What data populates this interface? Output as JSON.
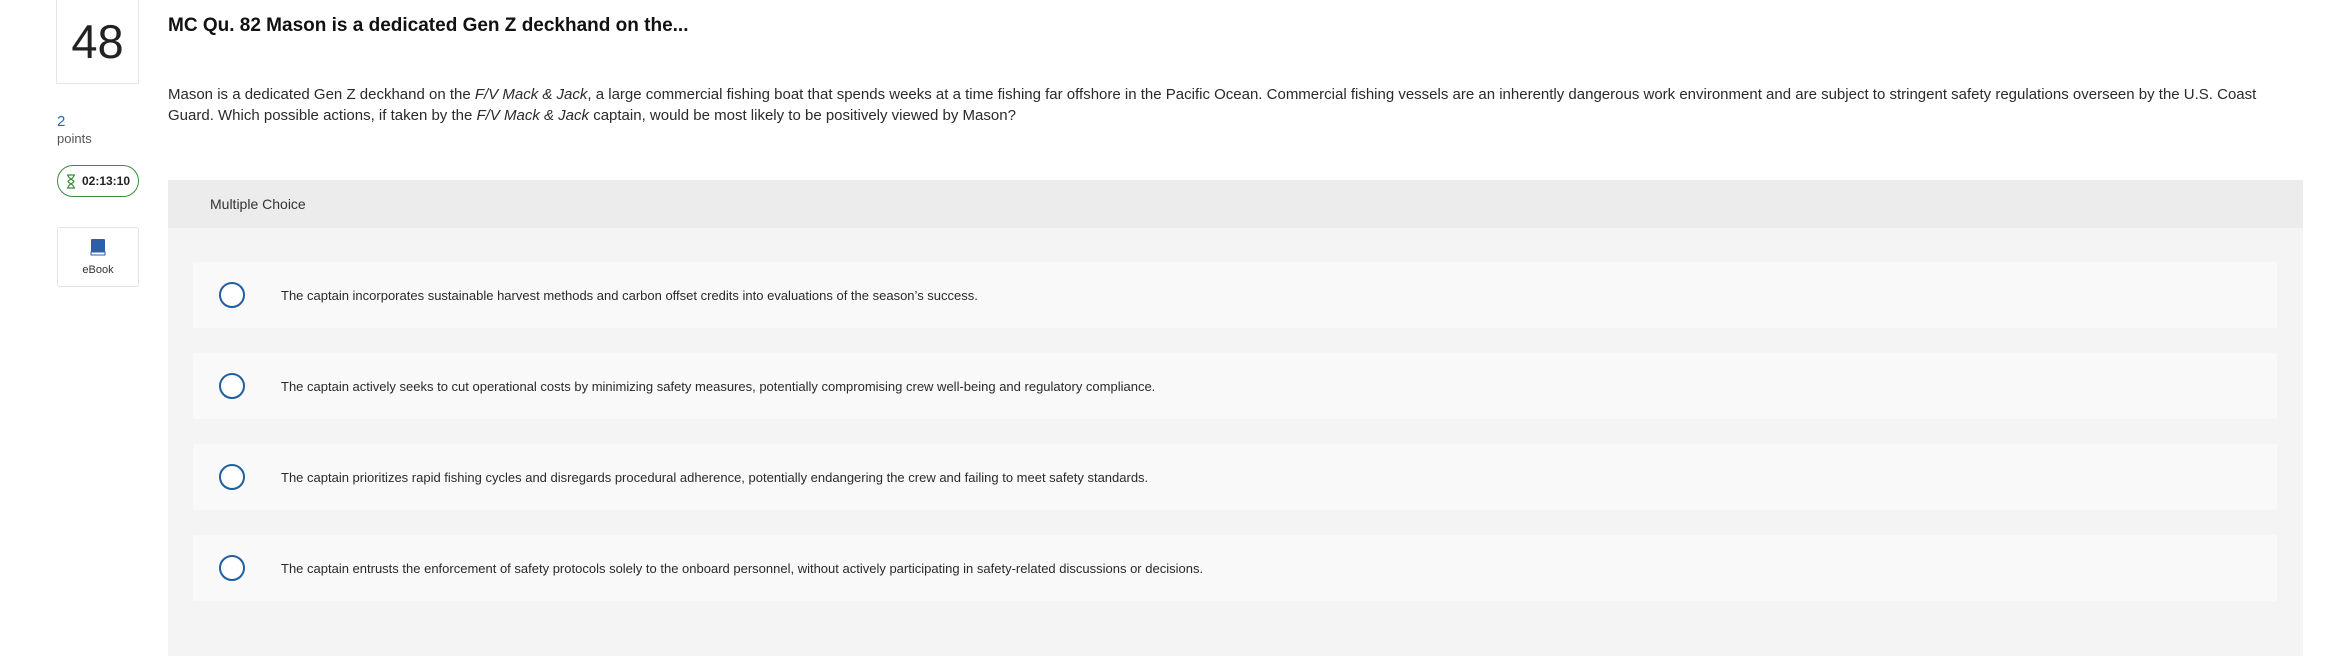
{
  "question": {
    "number": "48",
    "points_value": "2",
    "points_label": "points",
    "timer": "02:13:10",
    "ebook_label": "eBook",
    "title": "MC Qu. 82 Mason is a dedicated Gen Z deckhand on the...",
    "prompt_part1": "Mason is a dedicated Gen Z deckhand on the ",
    "prompt_vessel1": "F/V Mack & Jack",
    "prompt_part2": ", a large commercial fishing boat that spends weeks at a time fishing far offshore in the Pacific Ocean. Commercial fishing vessels are an inherently dangerous work environment and are subject to stringent safety regulations overseen by the U.S. Coast Guard. Which possible actions, if taken by the ",
    "prompt_vessel2": "F/V Mack & Jack",
    "prompt_part3": " captain, would be most likely to be positively viewed by Mason?"
  },
  "answer_section": {
    "type_label": "Multiple Choice",
    "choices": [
      {
        "text": "The captain incorporates sustainable harvest methods and carbon offset credits into evaluations of the season’s success."
      },
      {
        "text": "The captain actively seeks to cut operational costs by minimizing safety measures, potentially compromising crew well-being and regulatory compliance."
      },
      {
        "text": "The captain prioritizes rapid fishing cycles and disregards procedural adherence, potentially endangering the crew and failing to meet safety standards."
      },
      {
        "text": "The captain entrusts the enforcement of safety protocols solely to the onboard personnel, without actively participating in safety-related discussions or decisions."
      }
    ]
  },
  "icons": {
    "timer": "hourglass-icon",
    "ebook": "book-icon"
  },
  "colors": {
    "link_blue": "#2167b8",
    "radio_border": "#1f5f9e",
    "timer_border": "#3b8d3e",
    "ebook_icon": "#2d5ea8"
  }
}
